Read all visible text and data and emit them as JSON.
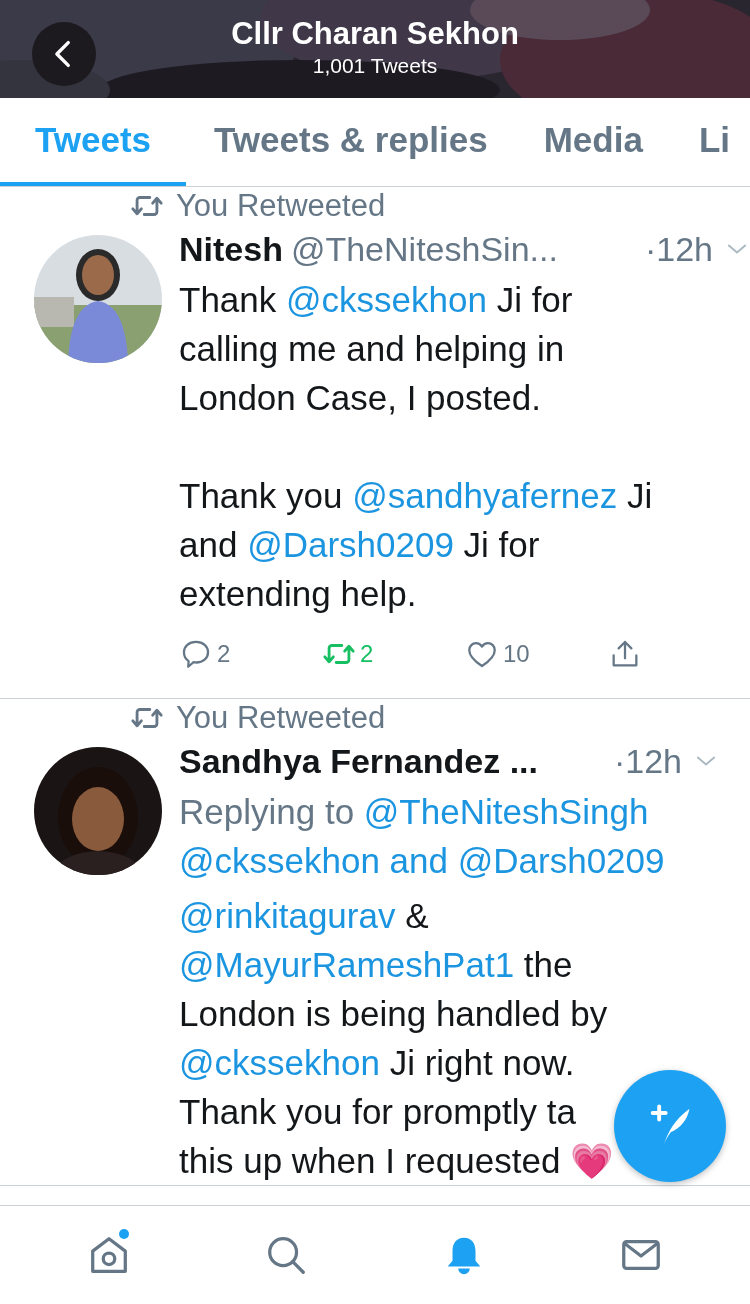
{
  "header": {
    "title": "Cllr Charan Sekhon",
    "subtitle": "1,001 Tweets"
  },
  "tabs": [
    {
      "label": "Tweets",
      "selected": true
    },
    {
      "label": "Tweets & replies",
      "selected": false
    },
    {
      "label": "Media",
      "selected": false
    },
    {
      "label": "Li",
      "selected": false
    }
  ],
  "tweets": [
    {
      "social_context": "You Retweeted",
      "name": "Nitesh",
      "handle": "@TheNiteshSin...",
      "time": "·12h",
      "paragraphs": [
        [
          [
            {
              "text": "Thank "
            },
            {
              "text": "@ckssekhon",
              "mention": true
            },
            {
              "text": " Ji for"
            }
          ],
          [
            {
              "text": "calling me and helping in"
            }
          ],
          [
            {
              "text": "London Case, I posted."
            }
          ]
        ],
        [
          [
            {
              "text": "Thank you "
            },
            {
              "text": "@sandhyafernez",
              "mention": true
            },
            {
              "text": " Ji"
            }
          ],
          [
            {
              "text": "and "
            },
            {
              "text": "@Darsh0209",
              "mention": true
            },
            {
              "text": " Ji for"
            }
          ],
          [
            {
              "text": "extending help."
            }
          ]
        ]
      ],
      "actions": [
        {
          "kind": "reply",
          "count": "2",
          "active": false
        },
        {
          "kind": "retweet",
          "count": "2",
          "active": true
        },
        {
          "kind": "like",
          "count": "10",
          "active": false
        },
        {
          "kind": "share",
          "active": false
        }
      ]
    },
    {
      "social_context": "You Retweeted",
      "name": "Sandhya Fernandez ...",
      "time": "·12h",
      "replying_to": [
        [
          {
            "text": "Replying to "
          },
          {
            "text": "@TheNiteshSingh",
            "mention": true
          }
        ],
        [
          {
            "text": "@ckssekhon and @Darsh0209",
            "mention": true
          }
        ]
      ],
      "paragraphs": [
        [
          [
            {
              "text": "@rinkitagurav",
              "mention": true
            },
            {
              "text": " &"
            }
          ],
          [
            {
              "text": "@MayurRameshPat1",
              "mention": true
            },
            {
              "text": " the"
            }
          ],
          [
            {
              "text": "London is being handled by"
            }
          ],
          [
            {
              "text": "@ckssekhon",
              "mention": true
            },
            {
              "text": " Ji right now."
            }
          ],
          [
            {
              "text": "Thank you for promptly ta"
            }
          ],
          [
            {
              "text": "this up when I requested 💗"
            }
          ]
        ]
      ]
    }
  ],
  "bottom_nav": [
    {
      "kind": "home",
      "selected": false,
      "badge": true
    },
    {
      "kind": "search",
      "selected": false,
      "badge": false
    },
    {
      "kind": "notifications",
      "selected": true,
      "badge": false
    },
    {
      "kind": "messages",
      "selected": false,
      "badge": false
    }
  ]
}
